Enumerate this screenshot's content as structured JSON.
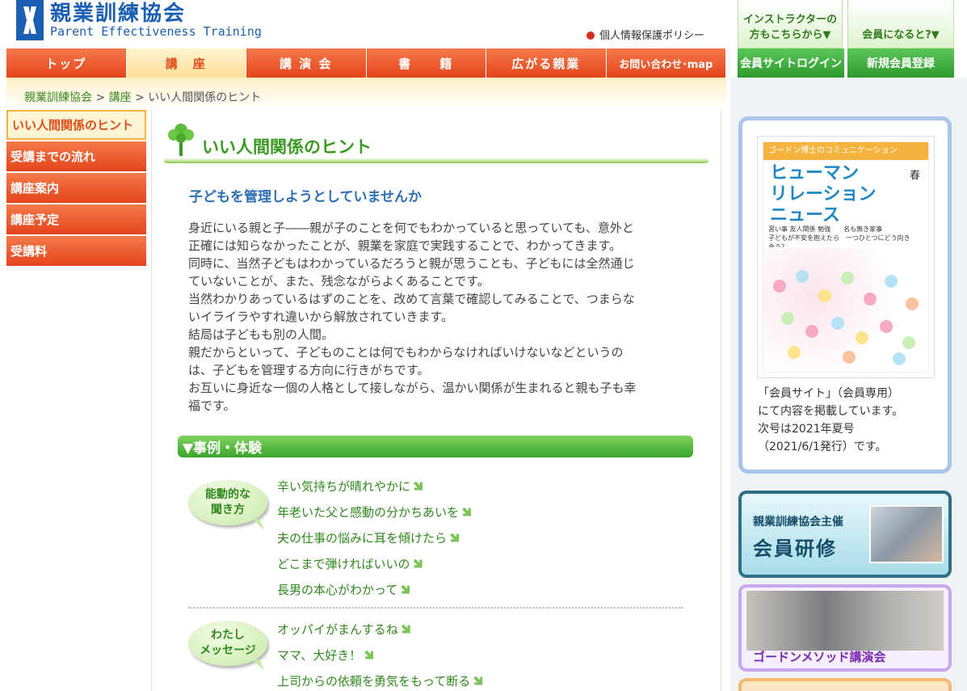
{
  "header": {
    "logo_jp": "親業訓練協会",
    "logo_en": "Parent Effectiveness Training",
    "privacy": "個人情報保護ポリシー"
  },
  "nav": [
    "トップ",
    "講　座",
    "講 演 会",
    "書　　籍",
    "広がる親業",
    "お問い合わせ･map"
  ],
  "right_top": {
    "instructor": "インストラクターの方もこちらから▼",
    "member": "会員になると?▼",
    "login": "会員サイトログイン",
    "register": "新規会員登録"
  },
  "breadcrumb": {
    "home": "親業訓練協会",
    "sep1": " > ",
    "course": "講座",
    "sep2": " > ",
    "current": "いい人間関係のヒント"
  },
  "sidebar": [
    "いい人間関係のヒント",
    "受講までの流れ",
    "講座案内",
    "講座予定",
    "受講料"
  ],
  "main": {
    "title": "いい人間関係のヒント",
    "subhead": "子どもを管理しようとしていませんか",
    "paragraph": [
      "身近にいる親と子――親が子のことを何でもわかっていると思っていても、意外と",
      "正確には知らなかったことが、親業を家庭で実践することで、わかってきます。",
      "同時に、当然子どもはわかっているだろうと親が思うことも、子どもには全然通じ",
      "ていないことが、また、残念ながらよくあることです。",
      "当然わかりあっているはずのことを、改めて言葉で確認してみることで、つまらな",
      "いイライラやすれ違いから解放されていきます。",
      "結局は子どもも別の人間。",
      "親だからといって、子どものことは何でもわからなければいけないなどというの",
      "は、子どもを管理する方向に行きがちです。",
      "お互いに身近な一個の人格として接しながら、温かい関係が生まれると親も子も幸",
      "福です。"
    ],
    "section": "▼事例・体験",
    "groups": [
      {
        "bubble": [
          "能動的な",
          "聞き方"
        ],
        "links": [
          "辛い気持ちが晴れやかに",
          "年老いた父と感動の分かちあいを",
          "夫の仕事の悩みに耳を傾けたら",
          "どこまで弾ければいいの",
          "長男の本心がわかって"
        ]
      },
      {
        "bubble": [
          "わたし",
          "メッセージ"
        ],
        "links": [
          "オッパイがまんするね",
          "ママ、大好き！",
          "上司からの依頼を勇気をもって断る"
        ]
      }
    ]
  },
  "right": {
    "book_header": "ゴードン博士のコミュニケーション",
    "book_title": [
      "ヒューマン",
      "リレーション",
      "ニュース"
    ],
    "book_season": "春",
    "book_lines": [
      "習い事 友人関係 勉強　　名も無き家事",
      "子どもが不安を抱えたら　一つひとつにどう向き合う？"
    ],
    "caption": [
      "「会員サイト」（会員専用）",
      "にて内容を掲載しています。",
      "次号は2021年夏号",
      "（2021/6/1発行）です。"
    ],
    "banner1_t1": "親業訓練協会主催",
    "banner1_t2": "会員研修",
    "banner2_t1": "ゴードンメソッド講演会"
  },
  "colors": {
    "nav_orange": "#e4451c",
    "green_text": "#3a9a23",
    "blue_subhead": "#2d6fb7",
    "brand_blue": "#1b5fb4"
  }
}
